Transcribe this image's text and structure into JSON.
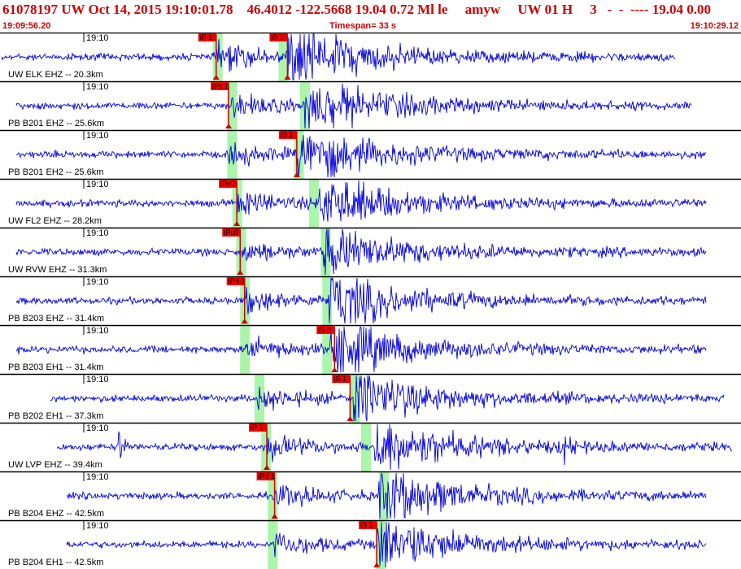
{
  "header": {
    "title": "61078197 UW Oct 14, 2015 19:10:01.78    46.4012 -122.5668 19.04 0.72 Ml le     amyw     UW 01 H     3   -  -  ---- 19.04 0.00",
    "time_start": "19:09:56.20",
    "timespan": "Timespan=  33 s",
    "time_end": "19:10:29.12"
  },
  "colors": {
    "trace": "#0000dd",
    "pick": "#cc0000",
    "pick_box": "#ee0000",
    "window": "#aaf5aa",
    "separator": "#000000"
  },
  "time_tick_label": "19:10",
  "traces": [
    {
      "label": "UW ELK EHZ -- 20.3km",
      "picks": [
        {
          "text": "iP 1",
          "t": 8.27
        },
        {
          "text": "iS 1",
          "t": 11.48
        }
      ],
      "windows": [
        8.12,
        11.08
      ],
      "onset": 8.27,
      "s_onset": 11.48,
      "amp": 1.0
    },
    {
      "label": "PB B201 EHZ -- 25.6km",
      "picks": [
        {
          "text": "iPc 1",
          "t": 8.83
        }
      ],
      "windows": [
        8.77,
        12.05
      ],
      "onset": 8.83,
      "s_onset": 12.25,
      "amp": 0.8
    },
    {
      "label": "PB B201 EH2 -- 25.6km",
      "picks": [
        {
          "text": "iS 1",
          "t": 11.9
        }
      ],
      "windows": [
        8.77,
        11.78
      ],
      "onset": 8.83,
      "s_onset": 11.9,
      "amp": 0.8
    },
    {
      "label": "UW FL2 EHZ -- 28.2km",
      "picks": [
        {
          "text": "iPc0",
          "t": 9.2
        }
      ],
      "windows": [
        9.0,
        12.45
      ],
      "onset": 9.2,
      "s_onset": 12.9,
      "amp": 0.8
    },
    {
      "label": "UW RVW EHZ -- 31.3km",
      "picks": [
        {
          "text": "iPc0",
          "t": 9.35
        }
      ],
      "windows": [
        9.18,
        12.98
      ],
      "onset": 9.35,
      "s_onset": 13.1,
      "amp": 0.7
    },
    {
      "label": "PB B203 EHZ -- 31.4km",
      "picks": [
        {
          "text": "iPd 1",
          "t": 9.55
        }
      ],
      "windows": [
        9.35,
        13.05
      ],
      "onset": 9.55,
      "s_onset": 13.3,
      "amp": 0.8
    },
    {
      "label": "PB B203 EH1 -- 31.4km",
      "picks": [
        {
          "text": "iS 0",
          "t": 13.6
        }
      ],
      "windows": [
        9.35,
        13.05
      ],
      "onset": 9.55,
      "s_onset": 13.35,
      "amp": 0.8
    },
    {
      "label": "PB B202 EH1 -- 37.3km",
      "picks": [
        {
          "text": "iS 1",
          "t": 14.3
        }
      ],
      "windows": [
        10.0,
        14.3
      ],
      "onset": 10.1,
      "s_onset": 14.4,
      "amp": 0.8
    },
    {
      "label": "UW LVP EHZ -- 39.4km",
      "picks": [
        {
          "text": "iP 1",
          "t": 10.55
        }
      ],
      "windows": [
        10.3,
        14.8
      ],
      "onset": 10.55,
      "s_onset": 15.4,
      "amp": 0.8
    },
    {
      "label": "PB B204 EHZ -- 42.5km",
      "picks": [
        {
          "text": "iPd 1",
          "t": 10.9
        }
      ],
      "windows": [
        10.6,
        15.6
      ],
      "onset": 10.9,
      "s_onset": 15.6,
      "amp": 0.8
    },
    {
      "label": "PB B204 EH1 -- 42.5km",
      "picks": [
        {
          "text": "iS 1",
          "t": 15.5
        }
      ],
      "windows": [
        10.6,
        15.45
      ],
      "onset": 10.9,
      "s_onset": 15.5,
      "amp": 0.8
    }
  ]
}
